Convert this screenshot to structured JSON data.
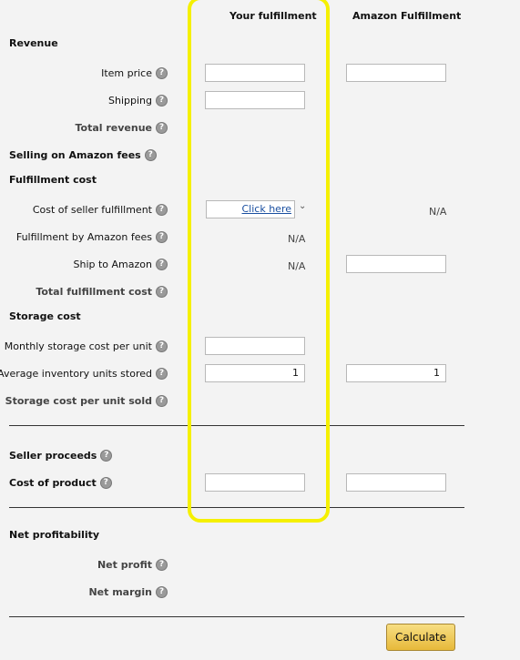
{
  "columns": {
    "yours": "Your fulfillment",
    "amazon": "Amazon Fulfillment"
  },
  "sections": {
    "revenue": "Revenue",
    "selling_fees": "Selling on Amazon fees",
    "fulfillment_cost": "Fulfillment cost",
    "storage_cost": "Storage cost",
    "seller_proceeds": "Seller proceeds",
    "cost_of_product": "Cost of product",
    "net_profitability": "Net profitability"
  },
  "labels": {
    "item_price": "Item price",
    "shipping": "Shipping",
    "total_revenue": "Total revenue",
    "cost_seller_fulfillment": "Cost of seller fulfillment",
    "fba_fees": "Fulfillment by Amazon fees",
    "ship_to_amazon": "Ship to Amazon",
    "total_fulfillment_cost": "Total fulfillment cost",
    "monthly_storage": "Monthly storage cost per unit",
    "avg_inventory": "Average inventory units stored",
    "storage_per_unit": "Storage cost per unit sold",
    "net_profit": "Net profit",
    "net_margin": "Net margin"
  },
  "values": {
    "na": "N/A",
    "click_here": "Click here",
    "avg_inventory_yours": "1",
    "avg_inventory_amazon": "1"
  },
  "help_glyph": "?",
  "calculate": "Calculate",
  "colors": {
    "highlight": "#f5f000",
    "button": "#f0c14b",
    "link": "#1a4fa0"
  }
}
